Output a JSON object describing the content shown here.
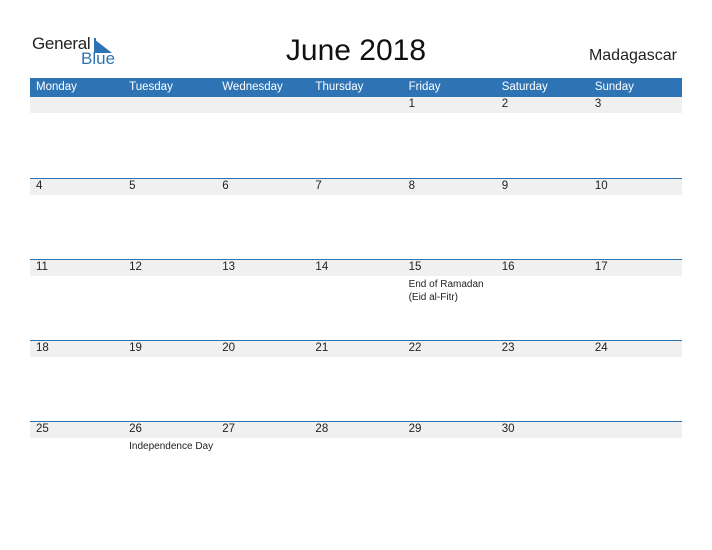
{
  "logo": {
    "word1": "General",
    "word2": "Blue"
  },
  "title": "June 2018",
  "country": "Madagascar",
  "colors": {
    "accent": "#2e74b5",
    "strip": "#f0f0f0"
  },
  "weekdays": [
    "Monday",
    "Tuesday",
    "Wednesday",
    "Thursday",
    "Friday",
    "Saturday",
    "Sunday"
  ],
  "weeks": [
    [
      {
        "day": ""
      },
      {
        "day": ""
      },
      {
        "day": ""
      },
      {
        "day": ""
      },
      {
        "day": "1"
      },
      {
        "day": "2"
      },
      {
        "day": "3"
      }
    ],
    [
      {
        "day": "4"
      },
      {
        "day": "5"
      },
      {
        "day": "6"
      },
      {
        "day": "7"
      },
      {
        "day": "8"
      },
      {
        "day": "9"
      },
      {
        "day": "10"
      }
    ],
    [
      {
        "day": "11"
      },
      {
        "day": "12"
      },
      {
        "day": "13"
      },
      {
        "day": "14"
      },
      {
        "day": "15",
        "event": "End of Ramadan (Eid al-Fitr)"
      },
      {
        "day": "16"
      },
      {
        "day": "17"
      }
    ],
    [
      {
        "day": "18"
      },
      {
        "day": "19"
      },
      {
        "day": "20"
      },
      {
        "day": "21"
      },
      {
        "day": "22"
      },
      {
        "day": "23"
      },
      {
        "day": "24"
      }
    ],
    [
      {
        "day": "25"
      },
      {
        "day": "26",
        "event": "Independence Day"
      },
      {
        "day": "27"
      },
      {
        "day": "28"
      },
      {
        "day": "29"
      },
      {
        "day": "30"
      },
      {
        "day": ""
      }
    ]
  ]
}
